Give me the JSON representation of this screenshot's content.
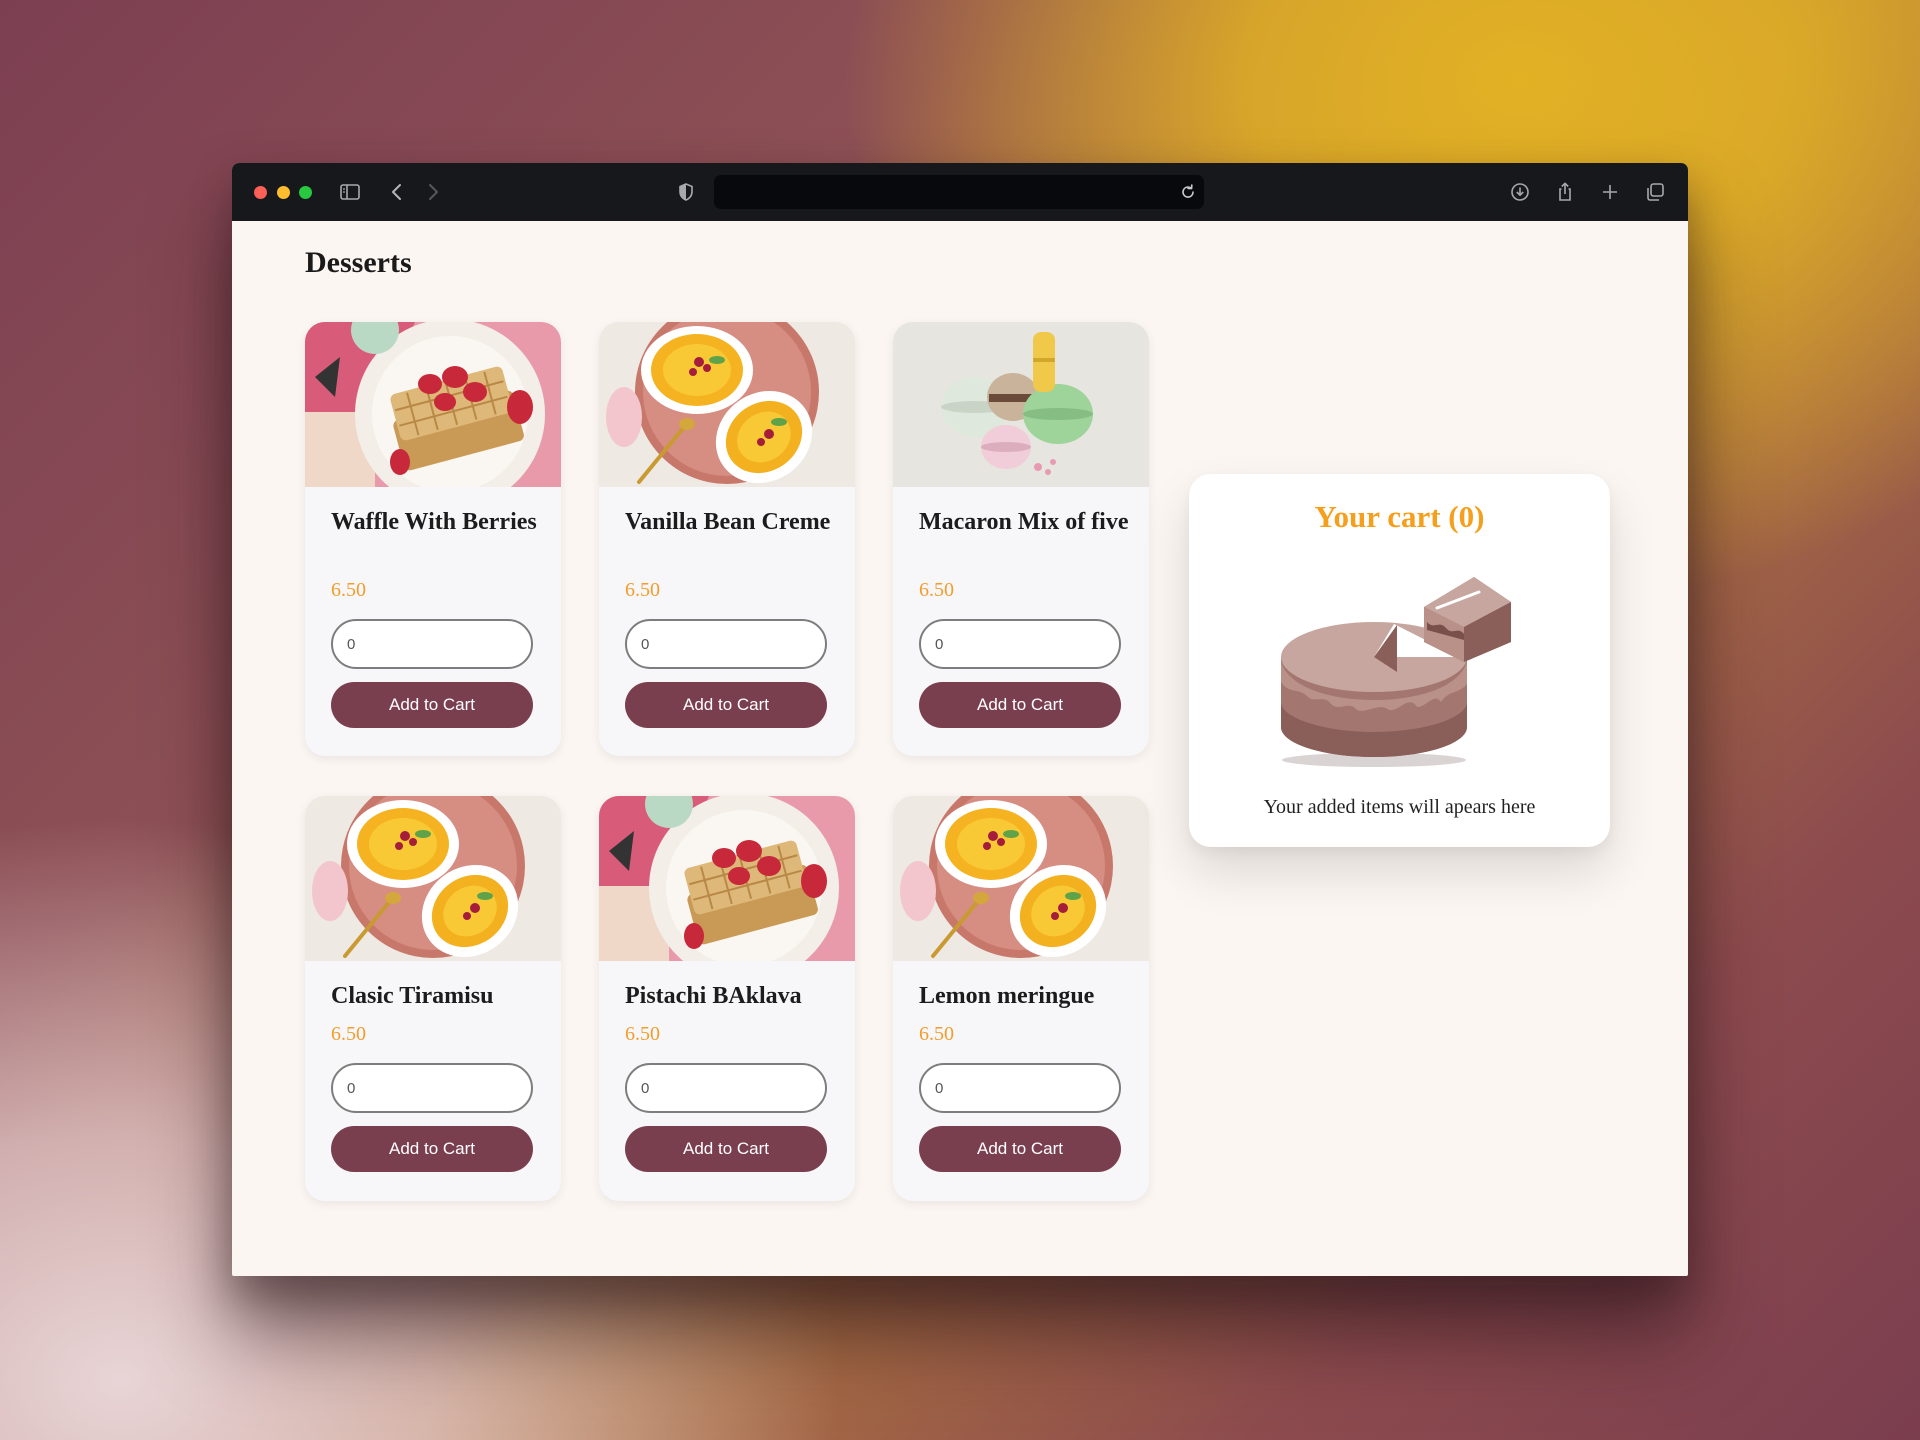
{
  "page": {
    "title": "Desserts"
  },
  "products": [
    {
      "name": "Waffle With Berries",
      "price": "6.50",
      "quantity_value": "0",
      "button_label": "Add to Cart",
      "image": "waffle"
    },
    {
      "name": "Vanilla Bean Creme",
      "price": "6.50",
      "quantity_value": "0",
      "button_label": "Add to Cart",
      "image": "creme"
    },
    {
      "name": "Macaron Mix of five",
      "price": "6.50",
      "quantity_value": "0",
      "button_label": "Add to Cart",
      "image": "macaron"
    },
    {
      "name": "Clasic Tiramisu",
      "price": "6.50",
      "quantity_value": "0",
      "button_label": "Add to Cart",
      "image": "creme"
    },
    {
      "name": "Pistachi BAklava",
      "price": "6.50",
      "quantity_value": "0",
      "button_label": "Add to Cart",
      "image": "waffle"
    },
    {
      "name": "Lemon meringue",
      "price": "6.50",
      "quantity_value": "0",
      "button_label": "Add to Cart",
      "image": "creme"
    }
  ],
  "cart": {
    "title": "Your cart (0)",
    "empty_message": "Your added items will apears here"
  },
  "colors": {
    "accent": "#f59f1c",
    "button": "#7a3f4e",
    "page_background": "#fcf6f2",
    "card_background": "#f7f7f9"
  }
}
